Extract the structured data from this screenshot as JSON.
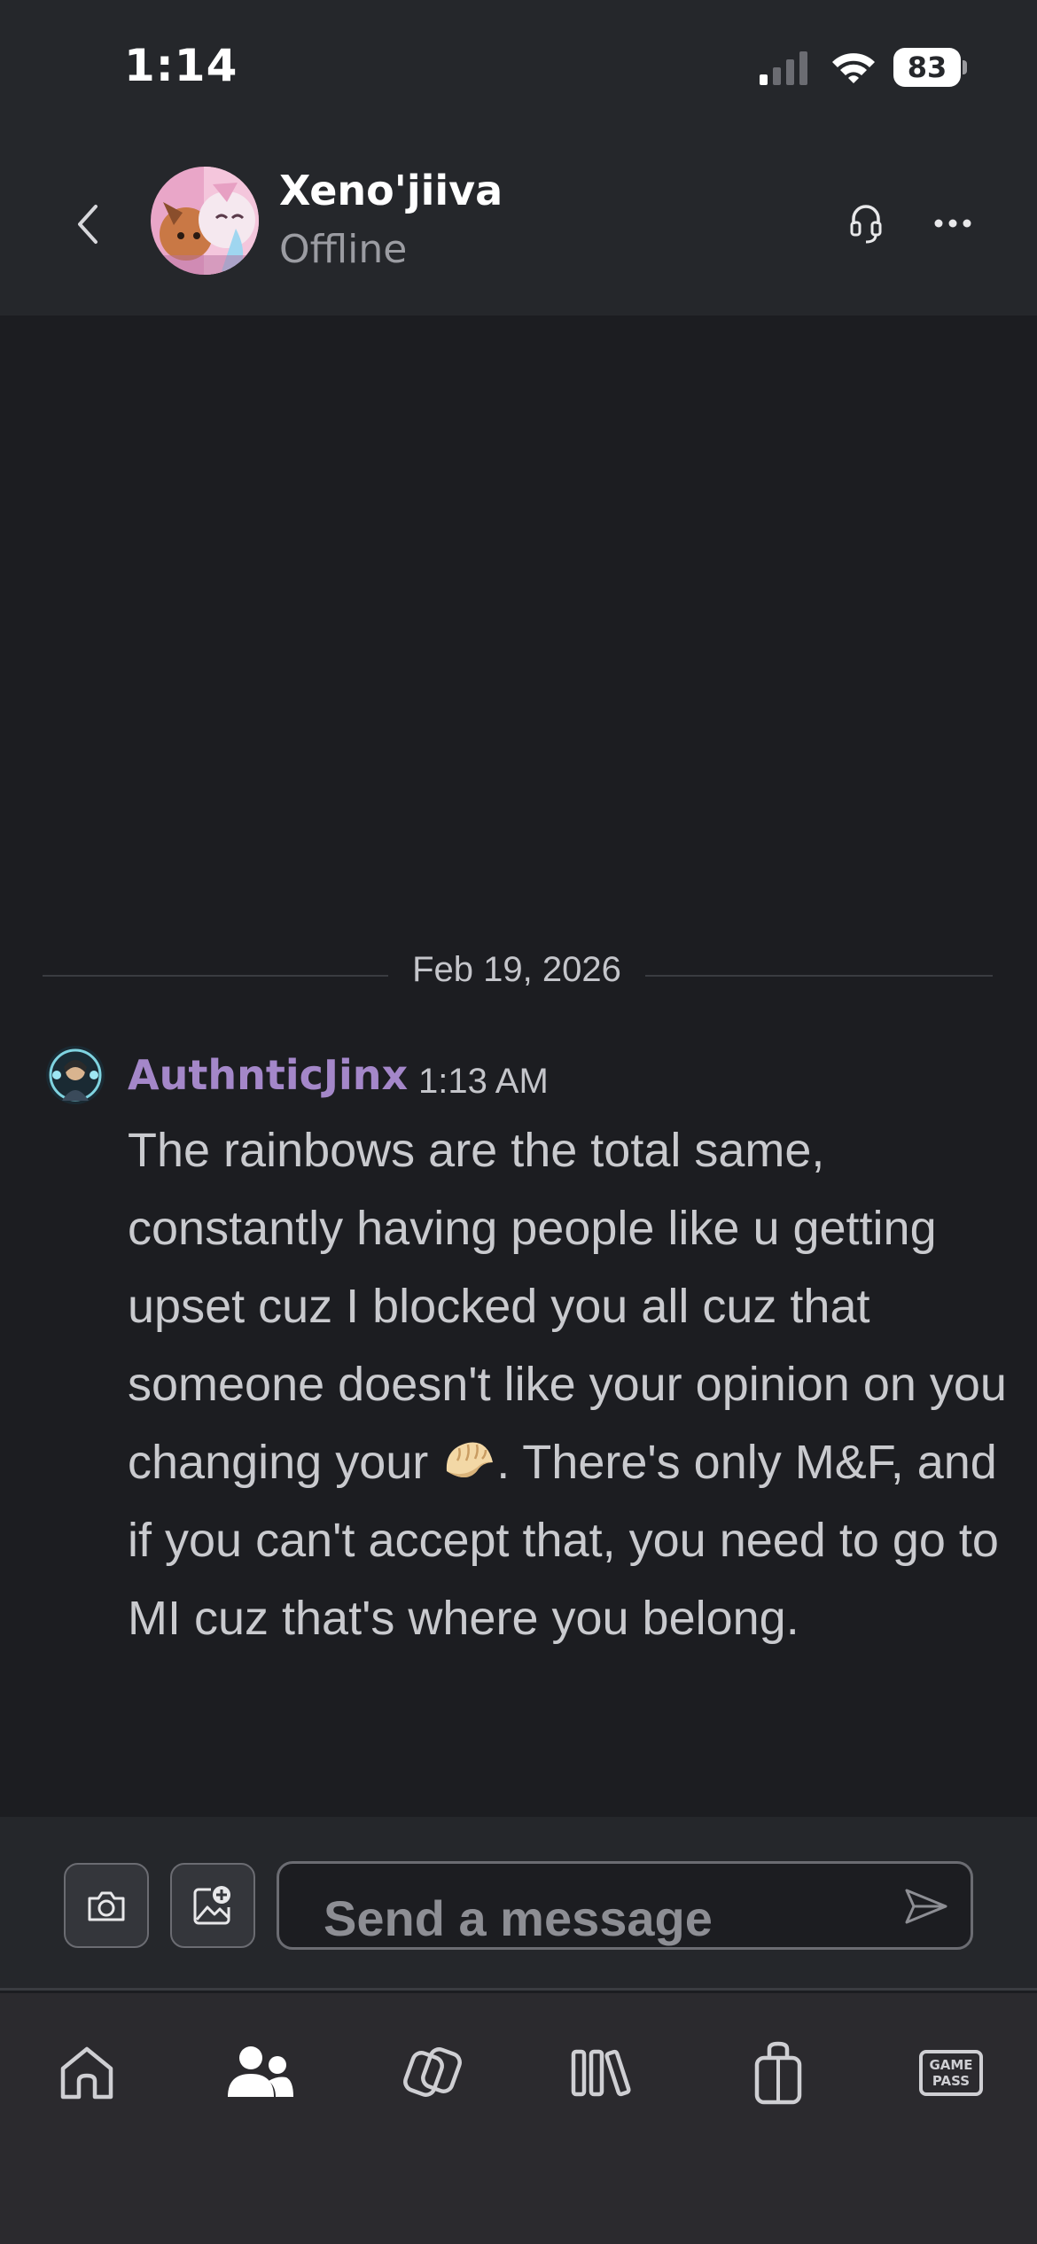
{
  "status_bar": {
    "time": "1:14",
    "battery": "83",
    "icons": [
      "signal-icon",
      "wifi-icon",
      "battery-icon"
    ]
  },
  "header": {
    "contact_name": "Xeno'jiiva",
    "contact_status": "Offline",
    "icons": [
      "back-chevron-icon",
      "headset-icon",
      "more-icon"
    ]
  },
  "chat": {
    "date": "Feb 19, 2026",
    "messages": [
      {
        "author": "AuthnticJinx",
        "time": "1:13 AM",
        "text_part1": "The rainbows are the total same, constantly having people like u getting upset cuz I blocked you all cuz that someone doesn't like your opinion on you changing your",
        "emoji": "dumpling-emoji",
        "text_part2": ". There's only M&F, and if you can't accept that, you need to go to MI cuz that's where you belong."
      }
    ]
  },
  "composer": {
    "placeholder": "Send a message",
    "icons": [
      "camera-icon",
      "add-image-icon",
      "send-icon"
    ]
  },
  "tab_bar": {
    "tabs": [
      {
        "name": "home",
        "icon": "home-icon"
      },
      {
        "name": "friends",
        "icon": "people-icon",
        "active": true
      },
      {
        "name": "social",
        "icon": "party-icon"
      },
      {
        "name": "library",
        "icon": "library-icon"
      },
      {
        "name": "store",
        "icon": "store-bag-icon"
      },
      {
        "name": "game-pass",
        "icon": "game-pass-icon",
        "label_line1": "GAME",
        "label_line2": "PASS"
      }
    ]
  },
  "colors": {
    "background": "#1c1d21",
    "header": "#25272b",
    "author_accent": "#a487c9",
    "tab_bar": "#2b2a2e"
  }
}
